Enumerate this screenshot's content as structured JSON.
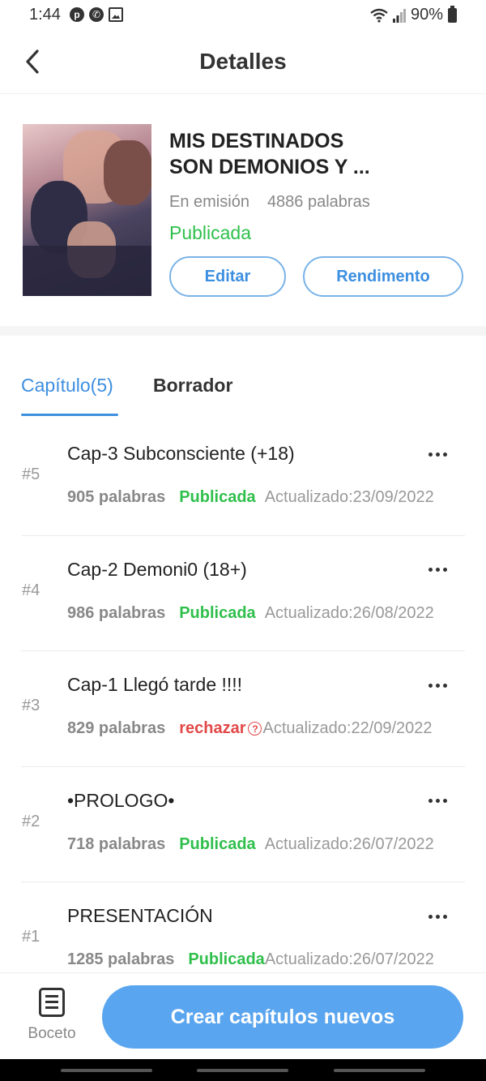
{
  "status_bar": {
    "time": "1:44",
    "battery": "90%",
    "left_icons": [
      "pinterest-icon",
      "whatsapp-icon",
      "gallery-icon"
    ]
  },
  "header": {
    "title": "Detalles"
  },
  "book": {
    "title_line1": "MIS DESTINADOS",
    "title_line2": "SON DEMONIOS Y ...",
    "state": "En emisión",
    "words": "4886 palabras",
    "status": "Publicada",
    "edit_label": "Editar",
    "performance_label": "Rendimento"
  },
  "tabs": {
    "chapters_label": "Capítulo(5)",
    "draft_label": "Borrador"
  },
  "chapters": [
    {
      "num": "#5",
      "title": "Cap-3 Subconsciente (+18)",
      "words": "905 palabras",
      "status": "Publicada",
      "updated": "Actualizado:23/09/2022"
    },
    {
      "num": "#4",
      "title": "Cap-2 Demoni0 (18+)",
      "words": "986 palabras",
      "status": "Publicada",
      "updated": "Actualizado:26/08/2022"
    },
    {
      "num": "#3",
      "title": "Cap-1 Llegó tarde !!!!",
      "words": "829 palabras",
      "status": "rechazar",
      "updated": "Actualizado:22/09/2022"
    },
    {
      "num": "#2",
      "title": "•PROLOGO•",
      "words": "718 palabras",
      "status": "Publicada",
      "updated": "Actualizado:26/07/2022"
    },
    {
      "num": "#1",
      "title": "PRESENTACIÓN",
      "words": "1285 palabras",
      "status": "Publicada",
      "updated": "Actualizado:26/07/2022"
    }
  ],
  "bottom": {
    "draft_label": "Boceto",
    "create_label": "Crear capítulos nuevos"
  },
  "colors": {
    "accent": "#3d8fe0",
    "published": "#2fbf4b",
    "rejected": "#e24848",
    "create_button": "#5aa5ef"
  }
}
